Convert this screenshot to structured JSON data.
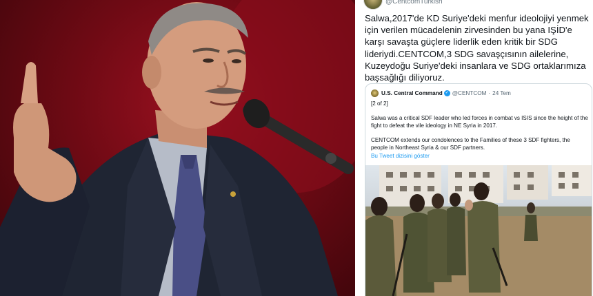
{
  "left_photo": {
    "description_icon": "man-speaking-photo"
  },
  "tweet": {
    "account_handle": "@CentcomTurkish",
    "text": "Salwa,2017'de KD Suriye'deki menfur ideolojiyi yenmek için verilen mücadelenin zirvesinden bu yana IŞİD'e karşı savaşta güçlere liderlik eden kritik bir SDG lideriydi.CENTCOM,3 SDG savaşçısının ailelerine, Kuzeydoğu Suriye'deki insanlara ve SDG ortaklarımıza başsağlığı diliyoruz."
  },
  "quoted_tweet": {
    "author_name": "U.S. Central Command",
    "verified_icon": "verified-badge-icon",
    "handle": "@CENTCOM",
    "separator": "·",
    "time": "24 Tem",
    "part_label": "[2 of 2]",
    "paragraph1": "Salwa was a critical SDF leader who led forces in combat vs ISIS since the height of the fight to defeat the vile ideology in NE Syria in 2017.",
    "paragraph2": "CENTCOM extends our condolences to the Families of these 3 SDF fighters, the people in Northeast Syria & our SDF partners.",
    "show_thread_link": "Bu Tweet dizisini göster",
    "photo_icon": "fighters-photo"
  },
  "colors": {
    "link": "#1d9bf0",
    "text": "#0f1419",
    "muted": "#536471",
    "border": "#cfd9de"
  }
}
